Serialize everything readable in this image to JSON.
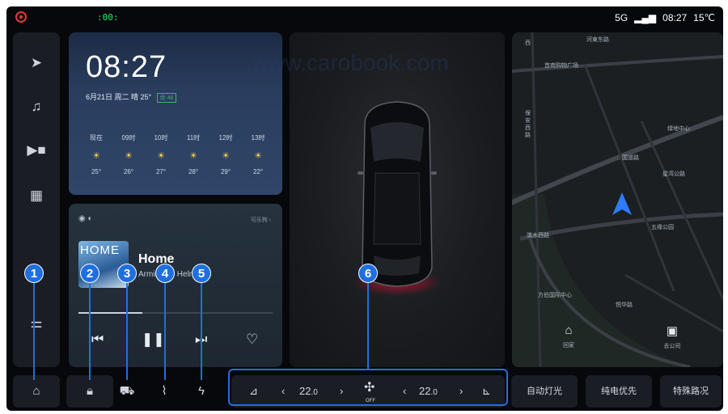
{
  "status": {
    "network": "5G",
    "time": "08:27",
    "temperature": "15℃",
    "lamp_indicator": ":00:"
  },
  "weather": {
    "time": "08:27",
    "date_line": "6月21日 周二  晴 25°",
    "aqi_badge": "优 46",
    "hours": [
      {
        "label": "现在",
        "temp": "25°"
      },
      {
        "label": "09时",
        "temp": "26°"
      },
      {
        "label": "10时",
        "temp": "27°"
      },
      {
        "label": "11时",
        "temp": "28°"
      },
      {
        "label": "12时",
        "temp": "29°"
      },
      {
        "label": "13时",
        "temp": "22°"
      }
    ]
  },
  "music": {
    "source_label": "可乐狗 ›",
    "song": "Home",
    "artist": "Armin van Helma",
    "album_text": "HOME",
    "progress": 0.33
  },
  "map": {
    "labels": [
      "西",
      "河東东路",
      "首商购物广场",
      "保安西路",
      "绿地中心",
      "国道路",
      "星湾公路",
      "五缘公园",
      "滨水西路",
      "方伯国际中心",
      "悦华路"
    ],
    "home_label": "回家",
    "company_label": "去公司"
  },
  "climate": {
    "left_temp": "22",
    "left_decimal": ".0",
    "right_temp": "22",
    "right_decimal": ".0",
    "fan_state": "OFF"
  },
  "quick_buttons": {
    "auto_light": "自动灯光",
    "ev_priority": "纯电优先",
    "special_road": "特殊路况"
  },
  "annotations": [
    "1",
    "2",
    "3",
    "4",
    "5",
    "6"
  ],
  "watermark": "www.carobook.com",
  "colors": {
    "accent": "#1f6fe0",
    "nav_arrow": "#2e7bff",
    "record": "#e53935",
    "tail_light": "#c8102e"
  }
}
